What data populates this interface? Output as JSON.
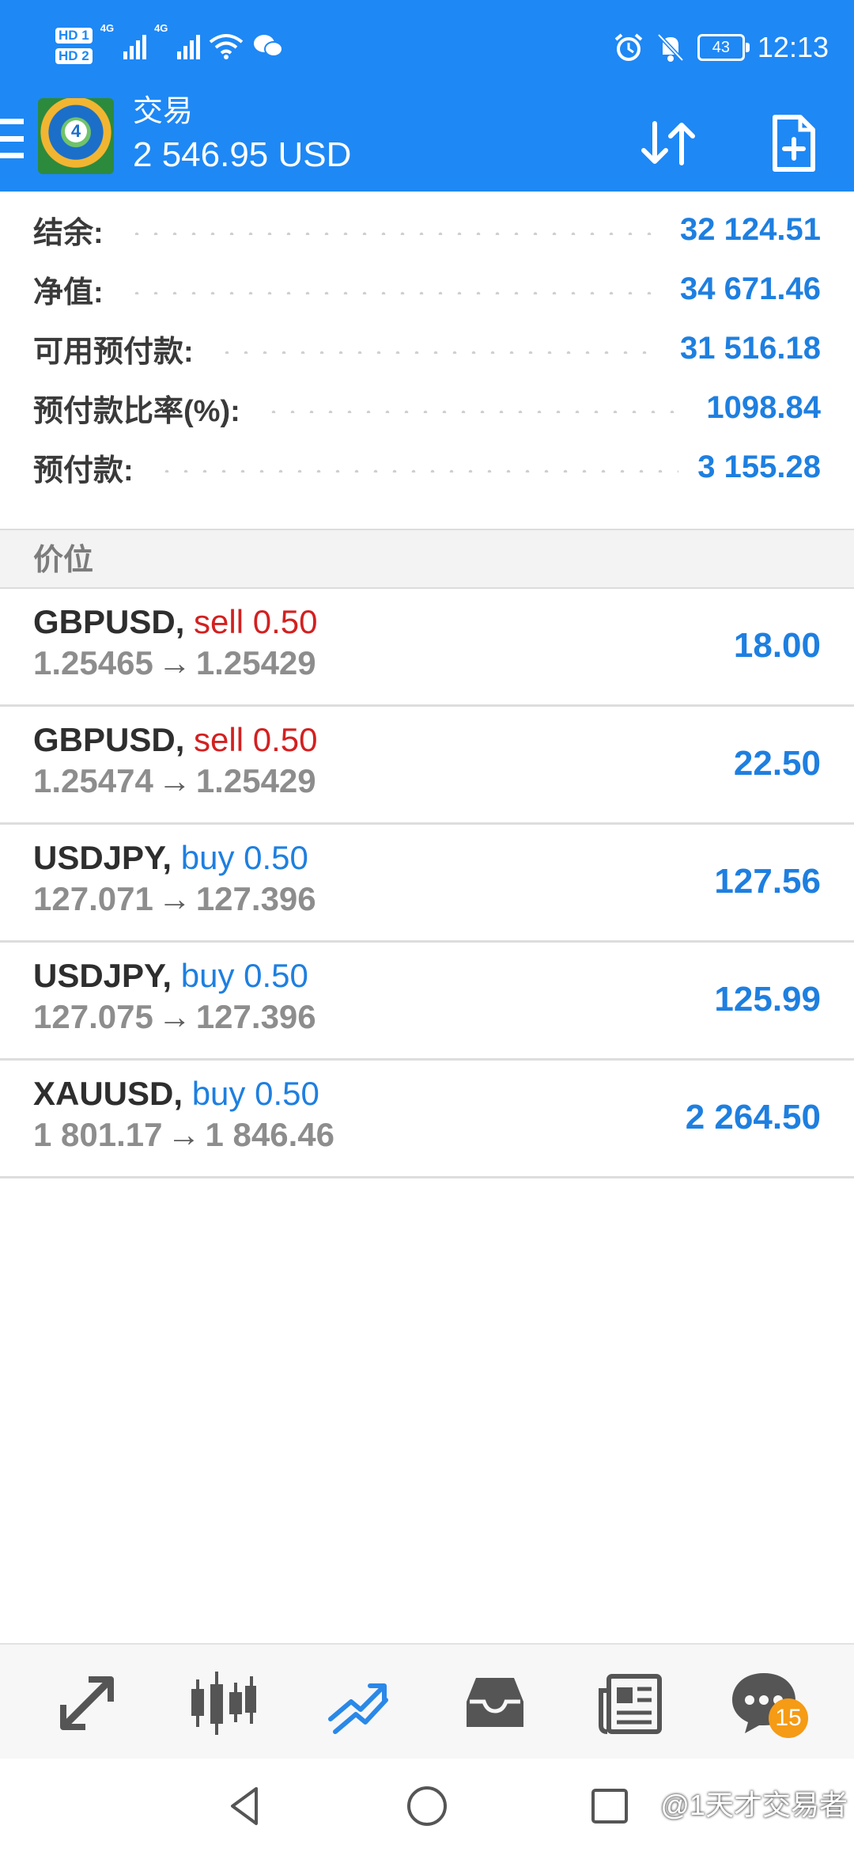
{
  "status_bar": {
    "hd1": "HD 1",
    "hd2": "HD 2",
    "net1": "4G",
    "net2": "4G",
    "battery": "43",
    "time": "12:13"
  },
  "app_bar": {
    "title": "交易",
    "balance": "2 546.95 USD",
    "logo_number": "4"
  },
  "summary": [
    {
      "label": "结余:",
      "value": "32 124.51"
    },
    {
      "label": "净值:",
      "value": "34 671.46"
    },
    {
      "label": "可用预付款:",
      "value": "31 516.18"
    },
    {
      "label": "预付款比率(%):",
      "value": "1098.84"
    },
    {
      "label": "预付款:",
      "value": "3 155.28"
    }
  ],
  "section_header": "价位",
  "positions": [
    {
      "symbol": "GBPUSD,",
      "side": "sell 0.50",
      "open": "1.25465",
      "current": "1.25429",
      "profit": "18.00"
    },
    {
      "symbol": "GBPUSD,",
      "side": "sell 0.50",
      "open": "1.25474",
      "current": "1.25429",
      "profit": "22.50"
    },
    {
      "symbol": "USDJPY,",
      "side": "buy 0.50",
      "open": "127.071",
      "current": "127.396",
      "profit": "127.56"
    },
    {
      "symbol": "USDJPY,",
      "side": "buy 0.50",
      "open": "127.075",
      "current": "127.396",
      "profit": "125.99"
    },
    {
      "symbol": "XAUUSD,",
      "side": "buy 0.50",
      "open": "1 801.17",
      "current": "1 846.46",
      "profit": "2 264.50"
    }
  ],
  "arrow": "→",
  "bottom_nav": {
    "items": [
      {
        "name": "quotes-icon"
      },
      {
        "name": "chart-icon"
      },
      {
        "name": "trade-icon"
      },
      {
        "name": "history-icon"
      },
      {
        "name": "news-icon"
      },
      {
        "name": "messages-icon"
      }
    ],
    "messages_badge": "15",
    "active_color": "#2a88e8",
    "inactive_color": "#555555"
  },
  "watermark": "@1天才交易者",
  "colors": {
    "brand": "#1e88f5",
    "profit": "#1e7fe0",
    "sell": "#d32020",
    "buy": "#1e7fe0"
  }
}
